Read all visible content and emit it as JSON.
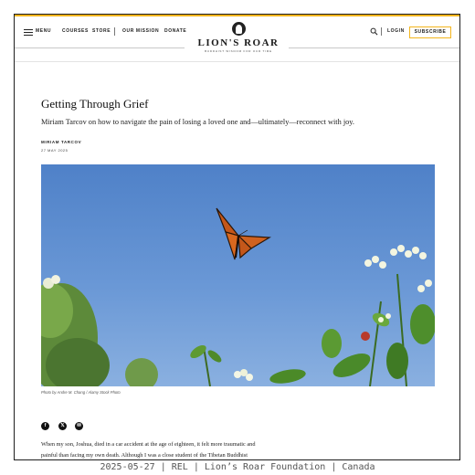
{
  "header": {
    "menu_label": "MENU",
    "nav": [
      "COURSES",
      "STORE",
      "OUR MISSION",
      "DONATE"
    ],
    "logo_title": "LION'S ROAR",
    "logo_tagline": "BUDDHIST WISDOM FOR OUR TIME",
    "login_label": "LOGIN",
    "subscribe_label": "SUBSCRIBE",
    "accent_color": "#f3b51c"
  },
  "article": {
    "title": "Getting Through Grief",
    "subtitle": "Miriam Tarcov on how to navigate the pain of losing a loved one and—ultimately—reconnect with joy.",
    "author": "MIRIAM TARCOV",
    "date": "27 MAY 2025",
    "photo_credit": "Photo by Andre M. Chang / Alamy Stock Photo",
    "social_icons": [
      "facebook-icon",
      "x-icon",
      "email-icon"
    ],
    "body_lines": [
      "When my son, Joshua, died in a car accident at the age of eighteen, it felt more traumatic and",
      "painful than facing my own death. Although I was a close student of the Tibetan Buddhist"
    ]
  },
  "caption": "2025-05-27 | REL | Lion’s Roar Foundation | Canada"
}
